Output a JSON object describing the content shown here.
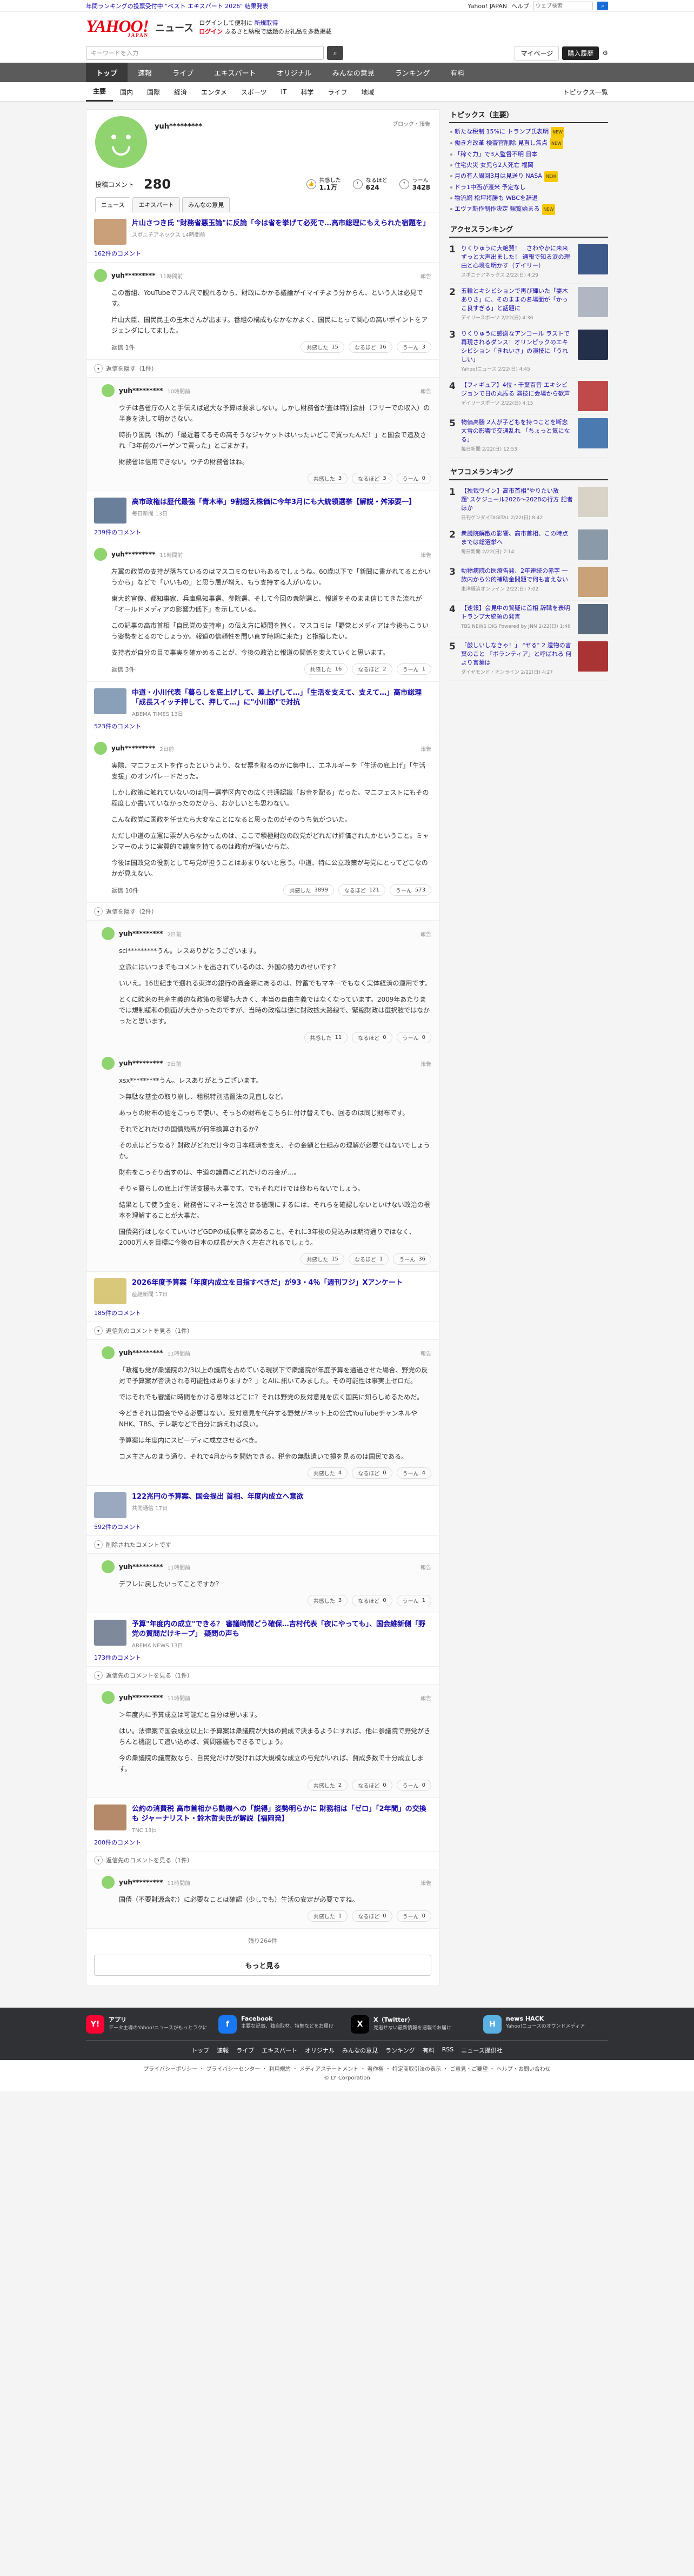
{
  "topbar": {
    "promo": "年間ランキングの投票受付中 \"ベスト エキスパート 2026\" 結果発表",
    "right": [
      "Yahoo! JAPAN",
      "ヘルプ"
    ],
    "search_placeholder": "ウェブ検索"
  },
  "header": {
    "logo": "YAHOO!",
    "logo_sub": "JAPAN",
    "service": "ニュース",
    "promo1a": "ログインして便利に",
    "promo1b": "新規取得",
    "promo2a": "ログイン",
    "promo2b": "ふるさと納税で話題のお礼品を多数掲載"
  },
  "search": {
    "placeholder": "キーワードを入力",
    "mypage": "マイページ",
    "buy": "購入履歴"
  },
  "nav1": [
    "トップ",
    "速報",
    "ライブ",
    "エキスパート",
    "オリジナル",
    "みんなの意見",
    "ランキング",
    "有料"
  ],
  "nav2": [
    "主要",
    "国内",
    "国際",
    "経済",
    "エンタメ",
    "スポーツ",
    "IT",
    "科学",
    "ライフ",
    "地域"
  ],
  "nav2_right": "トピックス一覧",
  "profile": {
    "name": "yuh*********",
    "report": "ブロック・報告",
    "label": "投稿コメント",
    "count": "280",
    "stats": [
      {
        "label": "共感した",
        "value": "1.1万"
      },
      {
        "label": "なるほど",
        "value": "624"
      },
      {
        "label": "うーん",
        "value": "3428"
      }
    ],
    "tabs": [
      "ニュース",
      "エキスパート",
      "みんなの意見"
    ]
  },
  "threads": [
    {
      "title": "片山さつき氏 \"財務省悪玉論\"に反論「今は省を挙げて必死で…高市総理にもえられた宿題を」",
      "source": "スポニチアネックス 14時間前",
      "comments_link": "162件のコメント",
      "comments": [
        {
          "name": "yuh*********",
          "time": "11時間前",
          "body": [
            "この番組、YouTubeでフル尺で観れるから、財政にかかる議論がイマイチよう分からん、という人は必見です。",
            "片山大臣、国民民主の玉木さんが出ます。番組の構成もなかなかよく、国民にとって関心の高いポイントをアジェンダにしてました。"
          ],
          "reply": "返信 1件",
          "r": [
            "15",
            "16",
            "3"
          ]
        }
      ],
      "toggle": "返信を隠す（1件）",
      "sub": [
        {
          "name": "yuh*********",
          "time": "10時間前",
          "body": [
            "ウチは各省庁の人と手伝えば過大な予算は要求しない。しかし財務省が査は特別会計（フリーでの収入）の半身を決して明かさない。",
            "時折り国民（私が）「最近着てるその高そうなジャケットはいったいどこで買ったんだ！」と国会で追及され「3年前のバーゲンで買った」とごまかす。",
            "財務省は信用できない。ウチの財務省はね。"
          ],
          "r": [
            "3",
            "3",
            "0"
          ]
        }
      ]
    },
    {
      "title": "高市政権は歴代最強「青木率」9割超え株価に今年3月にも大統領選挙【解説・舛添要一】",
      "source": "毎日新聞 13日",
      "comments_link": "239件のコメント",
      "comments": [
        {
          "name": "yuh*********",
          "time": "11時間前",
          "body": [
            "左翼の政党の支持が落ちているのはマスコミのせいもあるでしょうね。60歳以下で「新聞に書かれてるとかいうから」などで「いいもの」と思う層が増え、もう支持する人がいない。",
            "東大的官僚、都知事家、兵庫県知事選、参院選、そして今回の衆院選と、報道をそのまま信じてきた流れが「オールドメディアの影響力低下」を示している。",
            "この記事の高市首相「自民党の支持率」の伝え方に疑問を抱く。マスコミは「野党とメディアは今後もこういう姿勢をとるのでしょうか。報道の信頼性を問い直す時期に来た」と指摘したい。",
            "支持者が自分の目で事実を確かめることが、今後の政治と報道の関係を変えていくと思います。"
          ],
          "reply": "返信 3件",
          "r": [
            "16",
            "2",
            "1"
          ]
        }
      ]
    },
    {
      "title": "中道・小川代表「暮らしを底上げして、差上げして…」「生活を支えて、支えて…」高市総理「成長スイッチ押して、押して…」に\"小川節\"で対抗",
      "source": "ABEMA TIMES 13日",
      "comments_link": "523件のコメント",
      "comments": [
        {
          "name": "yuh*********",
          "time": "2日前",
          "body": [
            "実際、マニフェストを作ったというより、なぜ票を取るのかに集中し、エネルギーを「生活の底上げ」「生活支援」のオンパレードだった。",
            "しかし政策に触れていないのは同一選挙区内での広く共通認識「お金を配る」だった。マニフェストにもその程度しか書いていなかったのだから、おかしいとも思わない。",
            "こんな政党に国政を任せたら大変なことになると思ったのがそのうち気がついた。",
            "ただし中道の立憲に票が入らなかったのは、ここで積極財政の政党がどれだけ評価されたかということ。ミャンマーのように実質的で議席を持てるのは政府が強いからだ。",
            "今後は国政党の役割として与党が担うことはあまりないと思う。中道、特に公立政策が与党にとってどこなのかが見えない。"
          ],
          "reply": "返信 10件",
          "r": [
            "3899",
            "121",
            "573"
          ]
        }
      ],
      "toggle": "返信を隠す（2件）",
      "sub": [
        {
          "name": "yuh*********",
          "time": "2日前",
          "body": [
            "sci*********うん。レスありがとうございます。",
            "立派にはいつまでもコメントを出されているのは、外国の勢力のせいです？",
            "いいえ。16世紀まで遡れる東洋の銀行の資金源にあるのは、貯蓄でもマネーでもなく実体経済の運用です。",
            "とくに欧米の共産主義的な政策の影響も大きく、本当の自由主義ではなくなっています。2009年あたりまでは規制緩和の側面が大きかったのですが、当時の政権は逆に財政拡大路線で、緊縮財政は選択肢ではなかったと思います。"
          ],
          "r": [
            "11",
            "0",
            "0"
          ]
        },
        {
          "name": "yuh*********",
          "time": "2日前",
          "body": [
            "xsx*********うん。レスありがとうございます。",
            "＞無駄な基金の取り崩し、租税特別措置法の見直しなど。",
            "あっちの財布の話をこっちで使い、そっちの財布をこちらに付け替えても、回るのは同じ財布です。",
            "それでどれだけの国債残高が何年換算されるか？",
            "その点はどうなる？財政がどれだけ今の日本経済を支え、その金額と仕組みの理解が必要ではないでしょうか。",
            "財布をこっそり出すのは、中道の議員にどれだけのお金が…。",
            "そりゃ暮らしの底上げ生活支援も大事です。でもそれだけでは終わらないでしょう。",
            "結果として使う金を、財務省にマネーを流させる循環にするには、それらを確認しないといけない政治の根本を理解することが大事だ。",
            "国債発行はしなくていいけどGDPの成長率を高めること、それに3年後の見込みは期待通りではなく、2000万人を目標に今後の日本の成長が大きく左右されるでしょう。"
          ],
          "r": [
            "15",
            "1",
            "36"
          ]
        }
      ]
    },
    {
      "title": "2026年度予算案「年度内成立を目指すべきだ」が93・4％「週刊フジ」Xアンケート",
      "source": "産経新聞 17日",
      "comments_link": "185件のコメント",
      "comments": [],
      "toggle": "返信先のコメントを見る（1件）",
      "sub": [
        {
          "name": "yuh*********",
          "time": "11時間前",
          "body": [
            "「政権も党が衆議院の2/3以上の議席を占めている現状下で衆議院が年度予算を通過させた場合、野党の反対で予算案が否決される可能性はありますか？」とAIに訊いてみました。その可能性は事実上ゼロだ。",
            "ではそれでも審議に時間をかける意味はどこに？それは野党の反対意見を広く国民に知らしめるためだ。",
            "今どきそれは国会でやる必要はない。反対意見を代弁する野党がネット上の公式YouTubeチャンネルやNHK、TBS、テレ朝などで自分に訴えれば良い。",
            "予算案は年度内にスピーディに成立させるべき。",
            "コメ主さんのまう通り、それで4月からを開始できる。税金の無駄遣いで損を見るのは国民である。"
          ],
          "r": [
            "4",
            "0",
            "4"
          ]
        }
      ]
    },
    {
      "title": "122兆円の予算案、国会提出 首相、年度内成立へ意欲",
      "source": "共同通信 17日",
      "comments_link": "592件のコメント",
      "comments": [],
      "toggle": "削除されたコメントです",
      "sub": [
        {
          "name": "yuh*********",
          "time": "11時間前",
          "body": [
            "デフレに戻したいってことですか？"
          ],
          "r": [
            "3",
            "0",
            "1"
          ]
        }
      ]
    },
    {
      "title": "予算\"年度内の成立\"できる？ 審議時間どう確保…吉村代表「夜にやっても」、国会維新側「野党の質問だけキープ」 疑問の声も",
      "source": "ABEMA NEWS 13日",
      "comments_link": "173件のコメント",
      "comments": [],
      "toggle": "返信先のコメントを見る（1件）",
      "sub": [
        {
          "name": "yuh*********",
          "time": "11時間前",
          "body": [
            "＞年度内に予算成立は可能だと自分は思います。",
            "はい。法律案で国会成立以上に予算案は衆議院が大体の賛成で決まるようにすれば、他に参議院で野党がきちんと機能して追い込めば、質問審議もできるでしょう。",
            "今の衆議院の議席数なら、自民党だけが受ければ大規模な成立の与党がいれば、賛成多数で十分成立します。"
          ],
          "r": [
            "2",
            "0",
            "0"
          ]
        }
      ]
    },
    {
      "title": "公約の消費税 高市首相から動機への「説得」姿勢明らかに 財務相は「ゼロ」「2年間」の交換も ジャーナリスト・鈴木哲夫氏が解説【福岡発】",
      "source": "TNC 13日",
      "comments_link": "200件のコメント",
      "comments": [],
      "toggle": "返信先のコメントを見る（1件）",
      "sub": [
        {
          "name": "yuh*********",
          "time": "11時間前",
          "body": [
            "国債（不要財源含む）に必要なことは確認（少しでも）生活の安定が必要ですね。"
          ],
          "r": [
            "1",
            "0",
            "0"
          ]
        }
      ]
    }
  ],
  "pager": {
    "note": "残り264件",
    "more": "もっと見る"
  },
  "side": {
    "topics_title": "トピックス（主要）",
    "topics": [
      {
        "t": "新たな税制 15%に トランプ氏表明",
        "n": "NEW"
      },
      {
        "t": "働き方改革 検査官削除 見直し焦点",
        "n": "NEW"
      },
      {
        "t": "「稼ぐ力」で3人監督不明 日本",
        "n": ""
      },
      {
        "t": "住宅火災 女児ら2人死亡 福岡",
        "n": ""
      },
      {
        "t": "月の有人周回3月は見送り NASA",
        "n": "NEW"
      },
      {
        "t": "ドラ1中西が渡米 予定なし",
        "n": ""
      },
      {
        "t": "物流網 松坪将勝も WBCを辞退",
        "n": ""
      },
      {
        "t": "エヴァ新作制作決定 観覧始まる",
        "n": "NEW"
      }
    ],
    "access_title": "アクセスランキング",
    "access": [
      {
        "t": "りくりゅうに大絶賛！　さわやかに未来ずっと大声出ました！ 通報で知る涙の理由と心境を明かす（デイリー）",
        "s": "スポニチアネックス 2/22(日) 4:29"
      },
      {
        "t": "五輪とキシビションで再び輝いた「妻木ありさ」に、そのままの名場面が「かっこ良すぎる」と話題に",
        "s": "デイリースポーツ 2/22(日) 4:36"
      },
      {
        "t": "りくりゅうに感謝なアンコール ラストで再現されるダンス！オリンピックのエキシビション「きれいさ」の演技に「うれしい」",
        "s": "Yahoo!ニュース 2/22(日) 4:45"
      },
      {
        "t": "【フィギュア】4位・千葉百音 エキシビジョンで日の丸振る 演技に会場から歓声",
        "s": "デイリースポーツ 2/22(日) 4:15"
      },
      {
        "t": "物価高騰 2人が子どもを持つことを断念 大雪の影響で交通乱れ 「ちょっと気になる」",
        "s": "毎日新聞 2/22(日) 12:53"
      }
    ],
    "yafoo_title": "ヤフコメランキング",
    "yafoo": [
      {
        "t": "【独裁ワイン】高市首相\"やりたい放題\"スケジュール2026〜2028の行方 記者ほか",
        "s": "日刊ゲンダイDIGITAL 2/22(日) 8:42"
      },
      {
        "t": "衆議院解散の影響、高市首相、この時点までは総選挙へ",
        "s": "毎日新聞 2/22(日) 7:14"
      },
      {
        "t": "動物病院の医療告発、2年連続の赤字 一族内から公的補助金問題で何も言えない",
        "s": "東洋経済オンライン 2/22(日) 7:02"
      },
      {
        "t": "【速報】会見中の質疑に首相 辞職を表明 トランプ大統領の発言",
        "s": "TBS NEWS DIG Powered by JNN 2/22(日) 1:46"
      },
      {
        "t": "「厳しいしなきゃ！」 \"ヤる\" 2 遺物の言葉のこと 「ボランティア」と呼ばれる 何より言葉は",
        "s": "ダイヤモンド・オンライン 2/22(日) 4:27"
      }
    ]
  },
  "footer": {
    "apps": [
      {
        "t": "アプリ",
        "d": "データ主導のYahoo!ニュースがもっとラクに",
        "i": "Y!"
      },
      {
        "t": "Facebook",
        "d": "主要な記事、独自取材、特集などをお届け",
        "i": "f"
      },
      {
        "t": "X（Twitter）",
        "d": "見逃せない最新情報を速報でお届け",
        "i": "X"
      },
      {
        "t": "news HACK",
        "d": "Yahoo!ニュースのオウンドメディア",
        "i": "H"
      }
    ],
    "links": [
      "トップ",
      "速報",
      "ライブ",
      "エキスパート",
      "オリジナル",
      "みんなの意見",
      "ランキング",
      "有料",
      "RSS",
      "ニュース提供社"
    ],
    "bottom": "プライバシーポリシー ・ プライバシーセンター ・ 利用規約 ・ メディアステートメント ・ 著作権 ・ 特定商取引法の表示 ・ ご意見・ご要望 ・ ヘルプ・お問い合わせ",
    "copyright": "© LY Corporation"
  },
  "colors": {
    "brand_red": "#e60012",
    "link": "#1a0dab",
    "nav": "#5b5b5b",
    "avatar": "#8fd46f"
  }
}
